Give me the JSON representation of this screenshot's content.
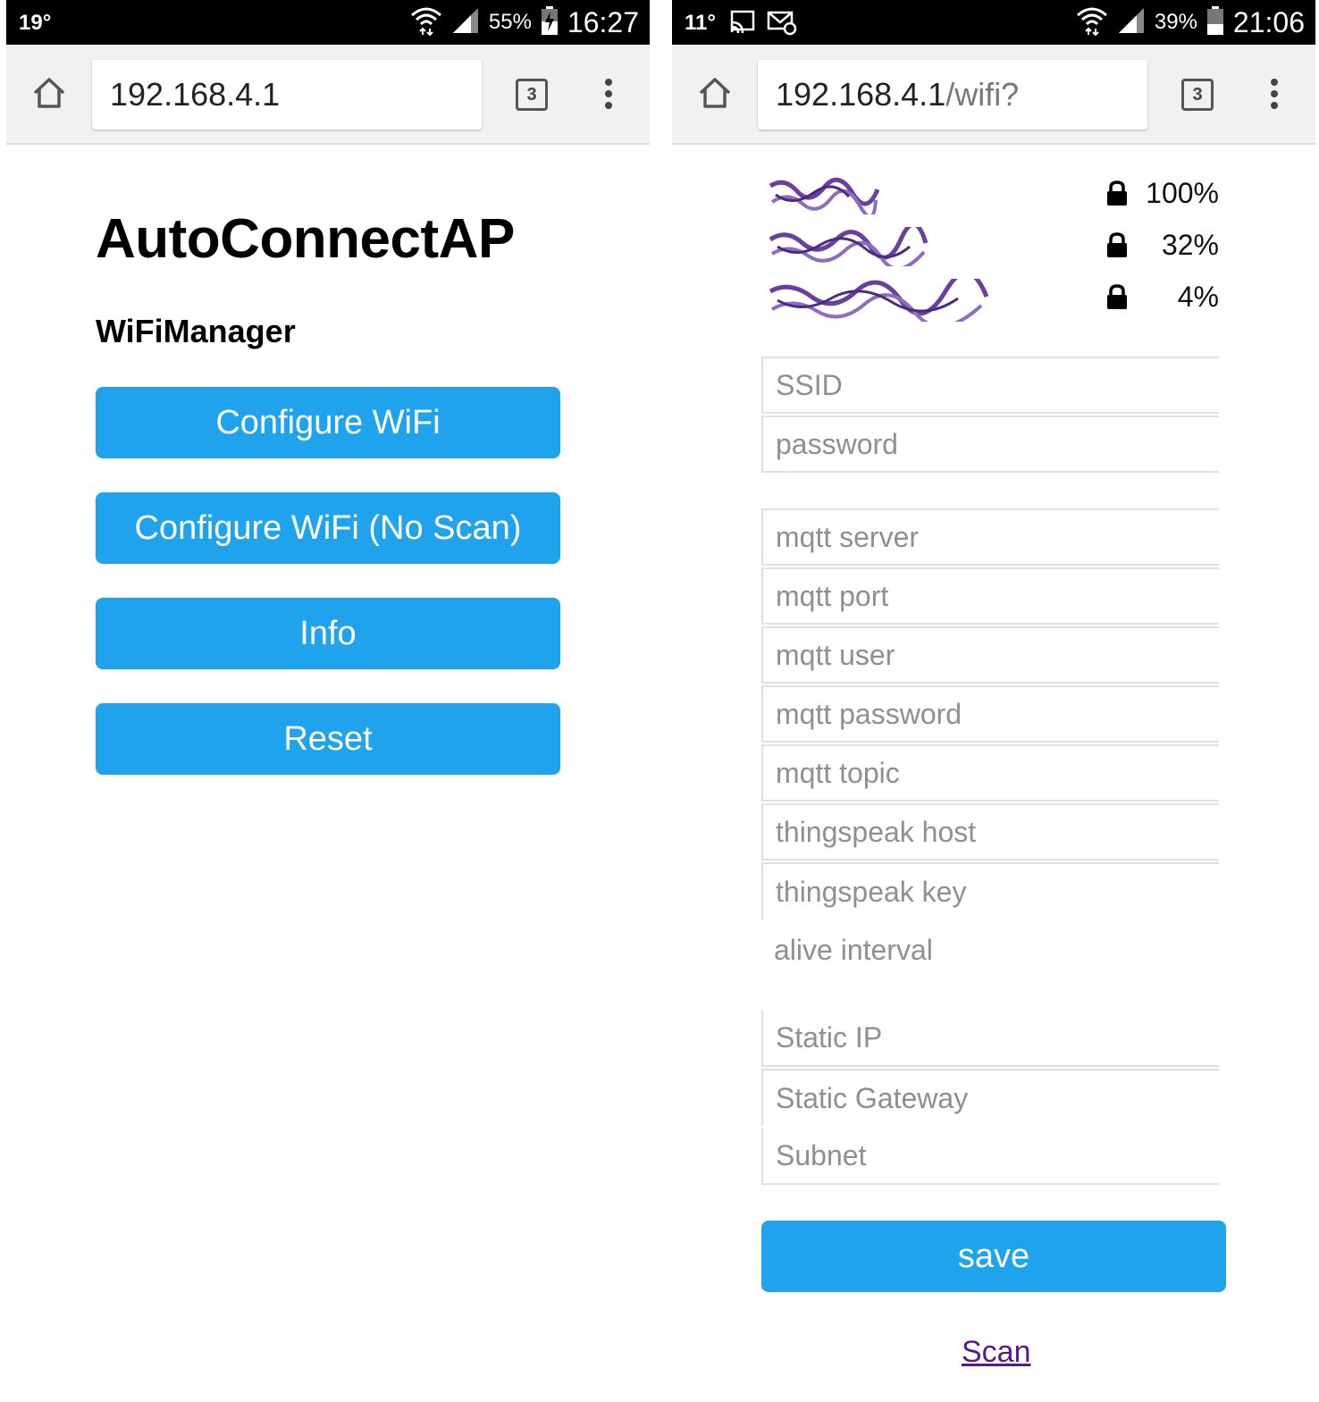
{
  "left_phone": {
    "status": {
      "temperature": "19°",
      "battery_pct": "55%",
      "time": "16:27"
    },
    "url": {
      "host": "192.168.4.1",
      "path": ""
    },
    "tab_count": "3",
    "page": {
      "title": "AutoConnectAP",
      "subtitle": "WiFiManager",
      "buttons": [
        "Configure WiFi",
        "Configure WiFi (No Scan)",
        "Info",
        "Reset"
      ]
    }
  },
  "right_phone": {
    "status": {
      "temperature": "11°",
      "battery_pct": "39%",
      "time": "21:06"
    },
    "url": {
      "host": "192.168.4.1",
      "path": "/wifi?"
    },
    "tab_count": "3",
    "networks": [
      {
        "signal": "100%",
        "locked": true
      },
      {
        "signal": "32%",
        "locked": true
      },
      {
        "signal": "4%",
        "locked": true
      }
    ],
    "fields": {
      "ssid": "SSID",
      "password": "password",
      "mqtt_server": "mqtt server",
      "mqtt_port": "mqtt port",
      "mqtt_user": "mqtt user",
      "mqtt_password": "mqtt password",
      "mqtt_topic": "mqtt topic",
      "thingspeak_host": "thingspeak host",
      "thingspeak_key": "thingspeak key",
      "alive_interval": "alive interval",
      "static_ip": "Static IP",
      "static_gateway": "Static Gateway",
      "subnet": "Subnet"
    },
    "save_label": "save",
    "scan_label": "Scan"
  },
  "colors": {
    "button_blue": "#1fa3ec",
    "link_purple": "#551a8b",
    "redaction_purple": "#6a3fa0"
  }
}
